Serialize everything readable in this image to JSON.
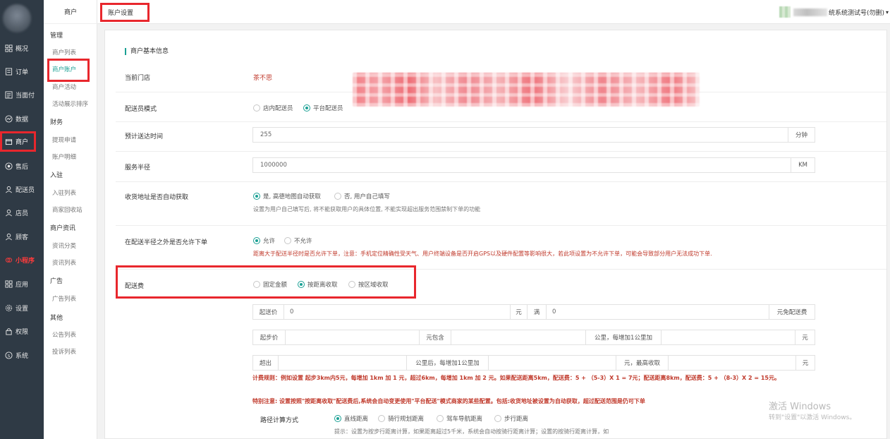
{
  "sidebar": {
    "items": [
      {
        "label": "概况",
        "icon": "dashboard-icon"
      },
      {
        "label": "订单",
        "icon": "order-icon"
      },
      {
        "label": "当面付",
        "icon": "pay-icon"
      },
      {
        "label": "数据",
        "icon": "data-icon"
      },
      {
        "label": "商户",
        "icon": "store-icon"
      },
      {
        "label": "售后",
        "icon": "after-sale-icon"
      },
      {
        "label": "配送员",
        "icon": "courier-icon"
      },
      {
        "label": "店员",
        "icon": "clerk-icon"
      },
      {
        "label": "顾客",
        "icon": "customer-icon"
      },
      {
        "label": "小程序",
        "icon": "miniprogram-icon"
      },
      {
        "label": "应用",
        "icon": "apps-icon"
      },
      {
        "label": "设置",
        "icon": "settings-icon"
      },
      {
        "label": "权限",
        "icon": "lock-icon"
      },
      {
        "label": "系统",
        "icon": "system-icon"
      }
    ]
  },
  "subnav": {
    "header": "商户",
    "groups": [
      {
        "title": "管理",
        "items": [
          "商户列表",
          "商户账户",
          "商户活动",
          "活动展示排序"
        ]
      },
      {
        "title": "财务",
        "items": [
          "提现申请",
          "账户明细"
        ]
      },
      {
        "title": "入驻",
        "items": [
          "入驻列表",
          "商家回收站"
        ]
      },
      {
        "title": "商户资讯",
        "items": [
          "资讯分类",
          "资讯列表"
        ]
      },
      {
        "title": "广告",
        "items": [
          "广告列表"
        ]
      },
      {
        "title": "其他",
        "items": [
          "公告列表",
          "投诉列表"
        ]
      }
    ]
  },
  "topbar": {
    "tab_title": "账户设置",
    "user_name": "统系统测试号(勿删)",
    "caret": "▾"
  },
  "form": {
    "section_title": "商户基本信息",
    "store": {
      "label": "当前门店",
      "value": "茶不思"
    },
    "delivery_mode": {
      "label": "配送员模式",
      "options": [
        "店内配送员",
        "平台配送员"
      ],
      "selected": 1
    },
    "eta": {
      "label": "预计送达时间",
      "value": "255",
      "unit": "分钟"
    },
    "radius": {
      "label": "服务半径",
      "value": "1000000",
      "unit": "KM"
    },
    "auto_address": {
      "label": "收货地址是否自动获取",
      "options": [
        "是, 高德地图自动获取",
        "否, 用户自己填写"
      ],
      "selected": 0,
      "hint": "设置为用户自己填写后, 将不能获取用户的具体位置, 不能实现超出服务范围禁制下单的功能"
    },
    "outside_radius": {
      "label": "在配送半径之外是否允许下单",
      "options": [
        "允许",
        "不允许"
      ],
      "selected": 0,
      "hint": "距离大于配送半径时是否允许下单，注意：手机定位精确性受天气、用户终端设备是否开启GPS以及硬件配置等影响很大，若此项设置为不允许下单，可能会导致部分用户无法成功下单."
    },
    "fee": {
      "label": "配送费",
      "options": [
        "固定金额",
        "按距离收取",
        "按区域收取"
      ],
      "selected": 1,
      "row1": {
        "start_label": "起送价",
        "start_value": "0",
        "unit1": "元",
        "full_label": "满",
        "full_value": "0",
        "free_label": "元免配送费"
      },
      "row2": {
        "base_label": "起步价",
        "base_value": "",
        "include_label": "元包含",
        "include_value": "",
        "per_label": "公里，每增加1公里加",
        "per_value": "",
        "unit": "元"
      },
      "row3": {
        "over_label": "超出",
        "over_value": "",
        "after_label": "公里后，每增加1公里加",
        "after_value": "",
        "max_label": "元，最高收取",
        "max_value": "",
        "unit": "元"
      },
      "rule": "计费规则：例如设置 起步3km内5元，每增加 1km 加 1 元，超过6km，每增加 1km 加 2 元。如果配送距离5km，配送费：5 + （5-3）X 1 = 7元；配送距离8km，配送费：5 + （8-3）X 2 = 15元。",
      "notice": "特别注意: 设置按照\"按距离收取\"配送费后,系统会自动变更使用\"平台配送\"模式商家的某些配置。包括:收货地址被设置为自动获取，超过配送范围是仍可下单"
    },
    "calc": {
      "label": "路径计算方式",
      "options": [
        "直线距离",
        "骑行规划距离",
        "驾车导航距离",
        "步行距离"
      ],
      "selected": 0,
      "hint": "提示：设置为按步行距离计算，如果距离超过5千米，系统会自动按骑行距离计算；设置的按骑行距离计算，如"
    }
  },
  "watermark": {
    "line1": "激活 Windows",
    "line2": "转到\"设置\"以激活 Windows。"
  },
  "colors": {
    "sidebar_bg": "#2f3a45",
    "accent": "#1aa094",
    "highlight": "#e8272d",
    "danger_text": "#c0392b"
  }
}
